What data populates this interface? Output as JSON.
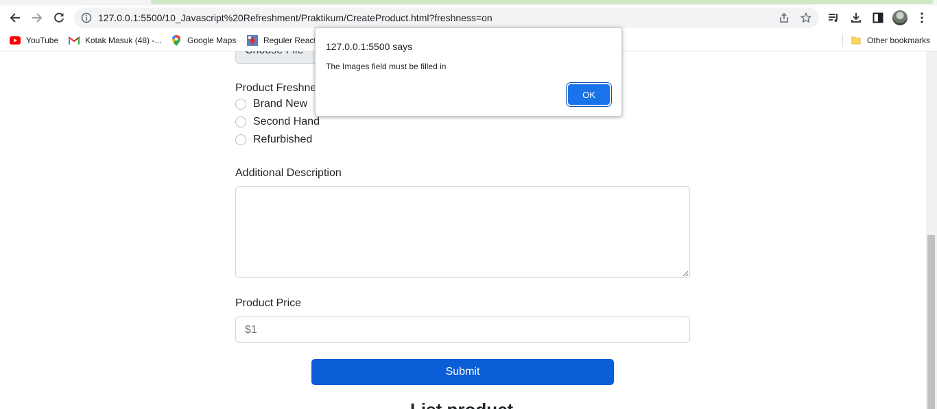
{
  "browser": {
    "url": "127.0.0.1:5500/10_Javascript%20Refreshment/Praktikum/CreateProduct.html?freshness=on",
    "bookmarks": [
      {
        "label": "YouTube",
        "icon": "youtube-icon"
      },
      {
        "label": "Kotak Masuk (48) -...",
        "icon": "gmail-icon"
      },
      {
        "label": "Google Maps",
        "icon": "maps-pin-icon"
      },
      {
        "label": "Reguler React",
        "icon": "bookmark-favicon-icon"
      }
    ],
    "other_bookmarks": "Other bookmarks"
  },
  "form": {
    "file_button": "Choose File",
    "freshness_label": "Product Freshness",
    "freshness_options": [
      "Brand New",
      "Second Hand",
      "Refurbished"
    ],
    "description_label": "Additional Description",
    "price_label": "Product Price",
    "price_placeholder": "$1",
    "submit_label": "Submit",
    "list_heading": "List product"
  },
  "dialog": {
    "title": "127.0.0.1:5500 says",
    "message": "The Images field must be filled in",
    "ok_label": "OK"
  },
  "colors": {
    "submit": "#0b5ed7",
    "ok_button": "#1a73e8"
  }
}
